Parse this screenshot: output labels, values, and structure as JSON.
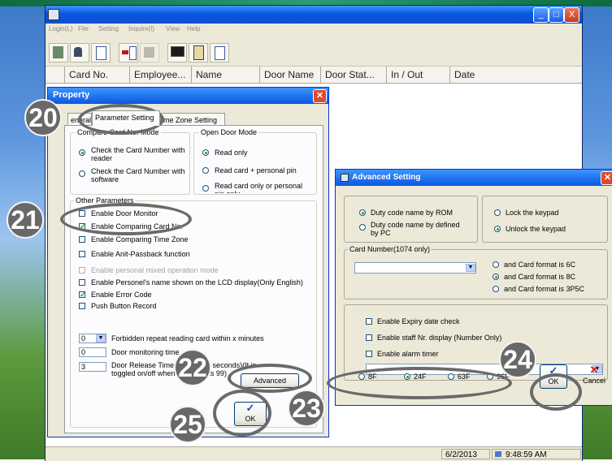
{
  "menu": [
    "Login(L)",
    "File",
    "Setting",
    "Inquire(I)",
    "View",
    "Help"
  ],
  "window_buttons": {
    "minimize": "_",
    "maximize": "□",
    "close": "X"
  },
  "grid_columns": [
    "",
    "Card No.",
    "Employee...",
    "Name",
    "Door Name",
    "Door Stat...",
    "In / Out",
    "Date"
  ],
  "status": {
    "date": "6/2/2013",
    "time": "9:48:59 AM"
  },
  "property": {
    "title": "Property",
    "tabs": [
      "eneral",
      "Parameter Setting",
      "me Zone Setting"
    ],
    "compare_group": "Compare Card No. Mode",
    "compare_opts": [
      "Check the Card Number with reader",
      "Check the Card Number with software"
    ],
    "open_door_group": "Open Door Mode",
    "open_door_opts": [
      "Read only",
      "Read card + personal pin",
      "Read card only or personal pin only"
    ],
    "other_group": "Other Parameters",
    "checks": [
      {
        "label": "Enable Door Monitor",
        "checked": false,
        "disabled": false
      },
      {
        "label": "Enable Comparing Card No.",
        "checked": true,
        "disabled": false
      },
      {
        "label": "Enable Comparing Time Zone",
        "checked": false,
        "disabled": false
      },
      {
        "label": "Enable Anit-Passback function",
        "checked": false,
        "disabled": false
      },
      {
        "label": "Enable personal mixed operation mode",
        "checked": false,
        "disabled": true
      },
      {
        "label": "Enable Personel's name shown on the LCD display(Only English)",
        "checked": false,
        "disabled": false
      },
      {
        "label": "Enable Error Code",
        "checked": true,
        "disabled": false
      },
      {
        "label": "Push Button Record",
        "checked": false,
        "disabled": false
      }
    ],
    "forbid_value": "0",
    "forbid_label": "Forbidden repeat reading card within x minutes",
    "monitor_value": "0",
    "monitor_label": "Door monitoring time",
    "release_value": "3",
    "release_label": "Door Release Time (unit of 0.5 seconds)(It is toggled on/off when the value is 99)",
    "advanced_label": "Advanced",
    "ok_label": "OK"
  },
  "advanced": {
    "title": "Advanced Setting",
    "duty_opts": [
      "Duty code name by ROM",
      "Duty code name by defined by PC"
    ],
    "keypad_opts": [
      "Lock the keypad",
      "Unlock the keypad"
    ],
    "card_group": "Card Number(1074 only)",
    "format_opts": [
      "and Card format is 6C",
      "and Card format is 8C",
      "and Card format is 3P5C"
    ],
    "checks": [
      "Enable Expiry date check",
      "Enable staff Nr. display (Number Only)",
      "Enable alarm timer"
    ],
    "floors": [
      "8F",
      "24F",
      "63F",
      "96F"
    ],
    "ok_label": "OK",
    "cancel_label": "Cancel"
  },
  "badges": [
    "20",
    "21",
    "22",
    "23",
    "24",
    "25"
  ]
}
